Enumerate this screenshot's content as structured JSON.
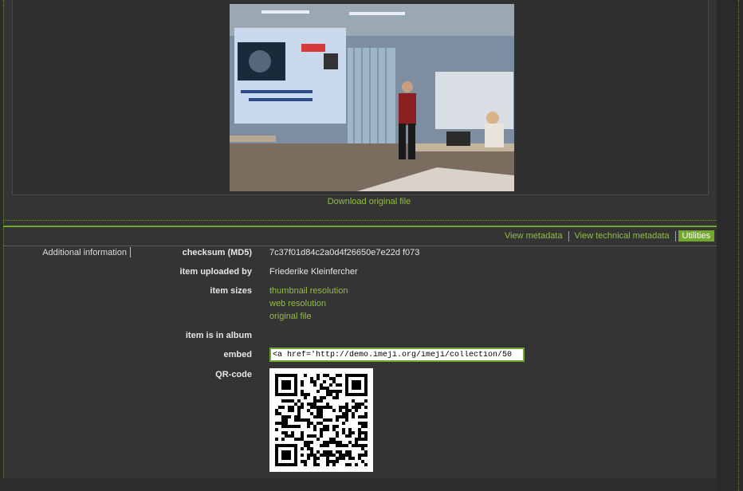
{
  "media": {
    "download_label": "Download original file"
  },
  "tabs": [
    {
      "label": "View metadata"
    },
    {
      "label": "View technical metadata"
    },
    {
      "label": "Utilities"
    }
  ],
  "details": {
    "section_label": "Additional information",
    "checksum_label": "checksum (MD5)",
    "checksum_value": "7c37f01d84c2a0d4f26650e7e22d f073",
    "uploader_label": "item uploaded by",
    "uploader_value": "Friederike Kleinfercher",
    "sizes_label": "item sizes",
    "sizes": [
      "thumbnail resolution",
      "web resolution",
      "original file"
    ],
    "album_label": "item is in album",
    "embed_label": "embed",
    "embed_value": "<a href='http://demo.imeji.org/imeji/collection/50",
    "qr_label": "QR-code"
  },
  "colors": {
    "accent": "#6fa82a",
    "link": "#8fbf3f",
    "background": "#343434"
  }
}
